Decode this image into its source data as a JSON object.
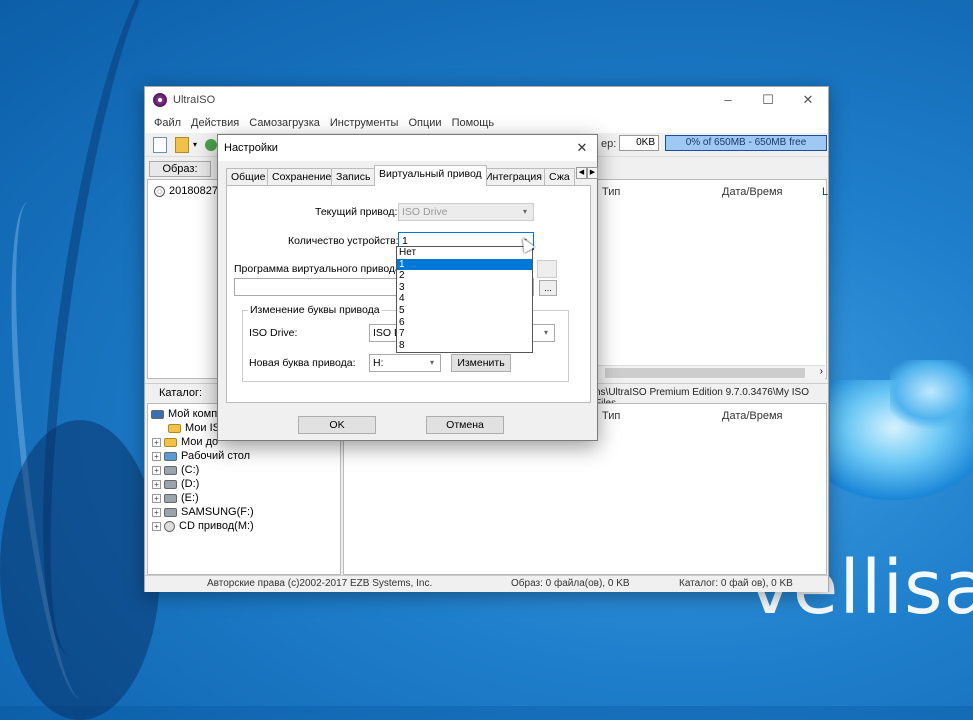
{
  "window": {
    "title": "UltraISO",
    "controls": [
      "–",
      "☐",
      "✕"
    ]
  },
  "menu": [
    "Файл",
    "Действия",
    "Самозагрузка",
    "Инструменты",
    "Опции",
    "Помощь"
  ],
  "toolbar": {
    "size_label": "ер:",
    "size_value": "0KB",
    "capacity": "0% of 650MB - 650MB free"
  },
  "image_bar": {
    "label": "Образ:"
  },
  "top_left": {
    "item": "20180827_"
  },
  "top_right": {
    "col_type": "Тип",
    "col_date": "Дата/Время",
    "col_extra": "L"
  },
  "catalog_bar": {
    "label": "Каталог:",
    "path": "ns\\UltraISO Premium Edition 9.7.0.3476\\My ISO Files"
  },
  "tree": [
    {
      "label": "Мой компь",
      "exp": ""
    },
    {
      "label": "Мои ISO",
      "exp": ""
    },
    {
      "label": "Мои до",
      "exp": "+"
    },
    {
      "label": "Рабочий стол",
      "exp": "+"
    },
    {
      "label": "(C:)",
      "exp": "+"
    },
    {
      "label": "(D:)",
      "exp": "+"
    },
    {
      "label": "(E:)",
      "exp": "+"
    },
    {
      "label": "SAMSUNG(F:)",
      "exp": "+"
    },
    {
      "label": "CD привод(M:)",
      "exp": "+"
    }
  ],
  "bottom_right": {
    "col_type": "Тип",
    "col_date": "Дата/Время"
  },
  "status": {
    "copyright": "Авторские права (c)2002-2017 EZB Systems, Inc.",
    "image": "Образ: 0 файла(ов), 0 KB",
    "catalog": "Каталог: 0 фай   ов), 0 KB"
  },
  "dialog": {
    "title": "Настройки",
    "close": "✕",
    "tabs": [
      "Общие",
      "Сохранение",
      "Запись",
      "Виртуальный привод",
      "Интеграция",
      "Сжа"
    ],
    "active_tab": "Виртуальный привод",
    "current_drive_label": "Текущий привод:",
    "current_drive_value": "ISO Drive",
    "device_count_label": "Количество устройств:",
    "device_count_value": "1",
    "program_label": "Программа виртуального привода:",
    "browse": "...",
    "group_title": "Изменение буквы привода",
    "iso_drive_label": "ISO Drive:",
    "iso_drive_value": "ISO Dr",
    "new_letter_label": "Новая буква привода:",
    "new_letter_value": "H:",
    "change_button": "Изменить",
    "ok": "OK",
    "cancel": "Отмена",
    "dropdown_options": [
      "Нет",
      "1",
      "2",
      "3",
      "4",
      "5",
      "6",
      "7",
      "8"
    ],
    "dropdown_selected": "1"
  },
  "watermark": "vellisa",
  "colors": {
    "accent": "#0078d7",
    "progress_fill": "#9fc8f4"
  }
}
